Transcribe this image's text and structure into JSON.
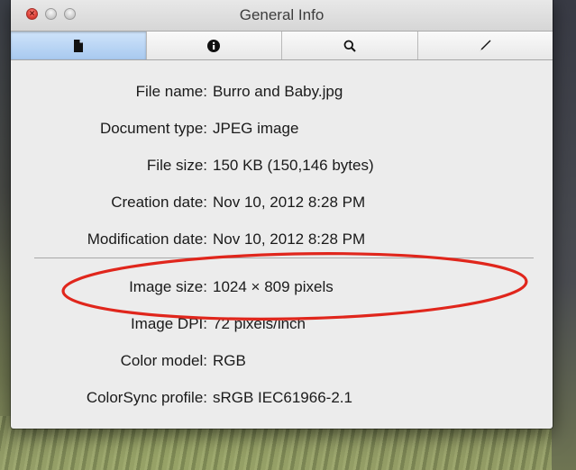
{
  "window": {
    "title": "General Info"
  },
  "toolbar": {
    "tabs": [
      {
        "icon": "document-icon",
        "active": true
      },
      {
        "icon": "info-icon",
        "active": false
      },
      {
        "icon": "magnifier-icon",
        "active": false
      },
      {
        "icon": "pen-icon",
        "active": false
      }
    ]
  },
  "info": {
    "rows": [
      {
        "label": "File name:",
        "value": "Burro and Baby.jpg"
      },
      {
        "label": "Document type:",
        "value": "JPEG image"
      },
      {
        "label": "File size:",
        "value": "150 KB (150,146 bytes)"
      },
      {
        "label": "Creation date:",
        "value": "Nov 10, 2012 8:28 PM"
      },
      {
        "label": "Modification date:",
        "value": "Nov 10, 2012 8:28 PM"
      },
      {
        "label": "Image size:",
        "value": "1024 × 809 pixels"
      },
      {
        "label": "Image DPI:",
        "value": "72 pixels/inch"
      },
      {
        "label": "Color model:",
        "value": "RGB"
      },
      {
        "label": "ColorSync profile:",
        "value": "sRGB IEC61966-2.1"
      }
    ]
  },
  "colors": {
    "annotation": "#e0261c",
    "selected_tab": "#b7d4f4"
  }
}
